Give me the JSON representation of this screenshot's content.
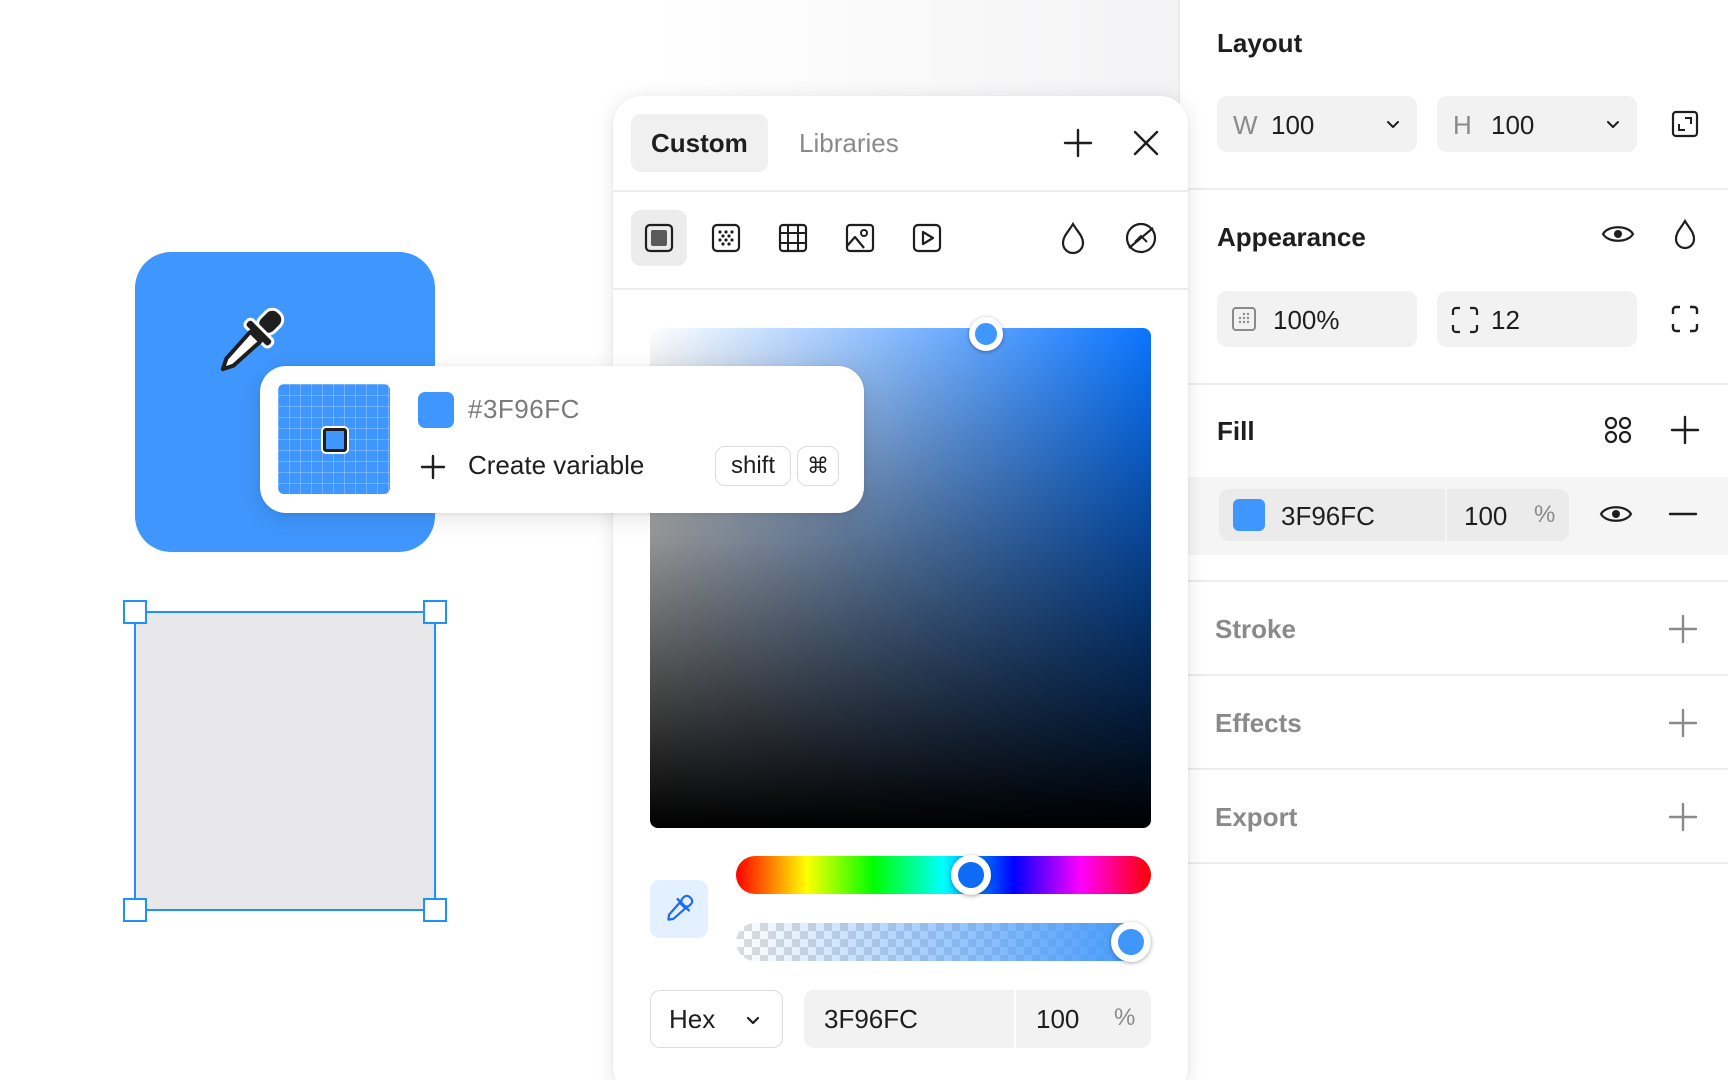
{
  "canvas": {
    "sample_popup": {
      "hex": "#3F96FC",
      "create_variable_label": "Create variable",
      "shortcut_shift": "shift",
      "shortcut_cmd": "⌘"
    },
    "sampled_color": "#3F96FC"
  },
  "color_picker": {
    "tabs": [
      {
        "label": "Custom",
        "active": true
      },
      {
        "label": "Libraries",
        "active": false
      }
    ],
    "paint_types": [
      "solid-icon",
      "gradient-icon",
      "pattern-icon",
      "image-icon",
      "video-icon"
    ],
    "mode_select": "Hex",
    "hex_value": "3F96FC",
    "alpha_value": "100",
    "alpha_unit": "%",
    "hue_position_fraction": 0.58,
    "alpha_fraction": 1.0
  },
  "properties": {
    "layout": {
      "title": "Layout",
      "width_label": "W",
      "width_value": "100",
      "height_label": "H",
      "height_value": "100"
    },
    "appearance": {
      "title": "Appearance",
      "opacity_value": "100%",
      "radius_value": "12"
    },
    "fill": {
      "title": "Fill",
      "hex": "3F96FC",
      "opacity": "100",
      "opacity_unit": "%",
      "color": "#3F96FC"
    },
    "stroke": {
      "title": "Stroke"
    },
    "effects": {
      "title": "Effects"
    },
    "export": {
      "title": "Export"
    }
  }
}
